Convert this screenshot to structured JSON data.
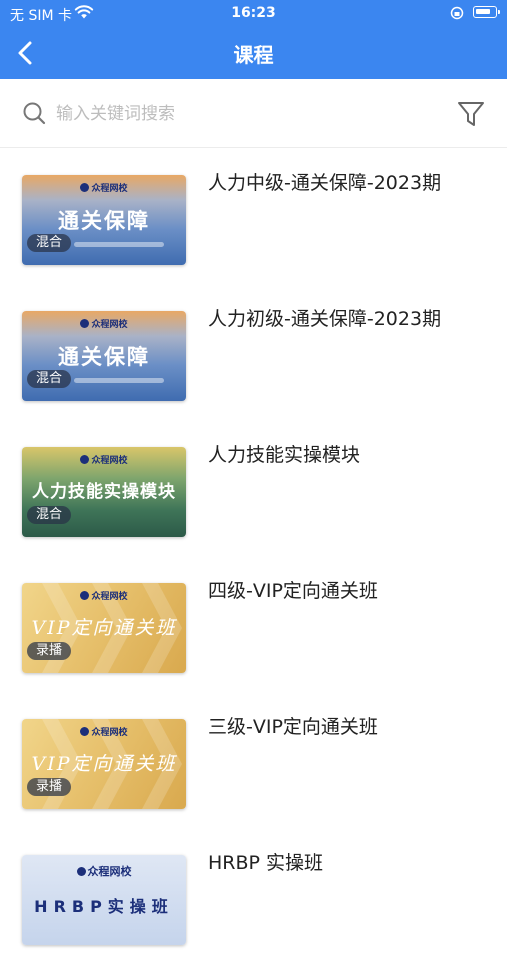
{
  "status_bar": {
    "carrier": "无 SIM 卡",
    "time": "16:23"
  },
  "nav": {
    "title": "课程"
  },
  "search": {
    "placeholder": "输入关键词搜索",
    "value": ""
  },
  "courses": [
    {
      "title": "人力中级-通关保障-2023期",
      "thumb_brand": "众程网校",
      "thumb_text": "通关保障",
      "badge": "混合",
      "style": "blue"
    },
    {
      "title": "人力初级-通关保障-2023期",
      "thumb_brand": "众程网校",
      "thumb_text": "通关保障",
      "badge": "混合",
      "style": "blue"
    },
    {
      "title": "人力技能实操模块",
      "thumb_brand": "众程网校",
      "thumb_text": "人力技能实操模块",
      "badge": "混合",
      "style": "green"
    },
    {
      "title": "四级-VIP定向通关班",
      "thumb_brand": "众程网校",
      "thumb_text": "VIP定向通关班",
      "badge": "录播",
      "style": "gold"
    },
    {
      "title": "三级-VIP定向通关班",
      "thumb_brand": "众程网校",
      "thumb_text": "VIP定向通关班",
      "badge": "录播",
      "style": "gold"
    },
    {
      "title": "HRBP 实操班",
      "thumb_brand": "众程网校",
      "thumb_text": "HRBP实操班",
      "badge": "",
      "style": "hrbp"
    }
  ],
  "colors": {
    "header": "#3b86f0",
    "background": "#ffffff"
  },
  "icons": {
    "back": "chevron-left-icon",
    "search": "search-icon",
    "filter": "filter-icon",
    "wifi": "wifi-icon",
    "battery": "battery-icon"
  }
}
